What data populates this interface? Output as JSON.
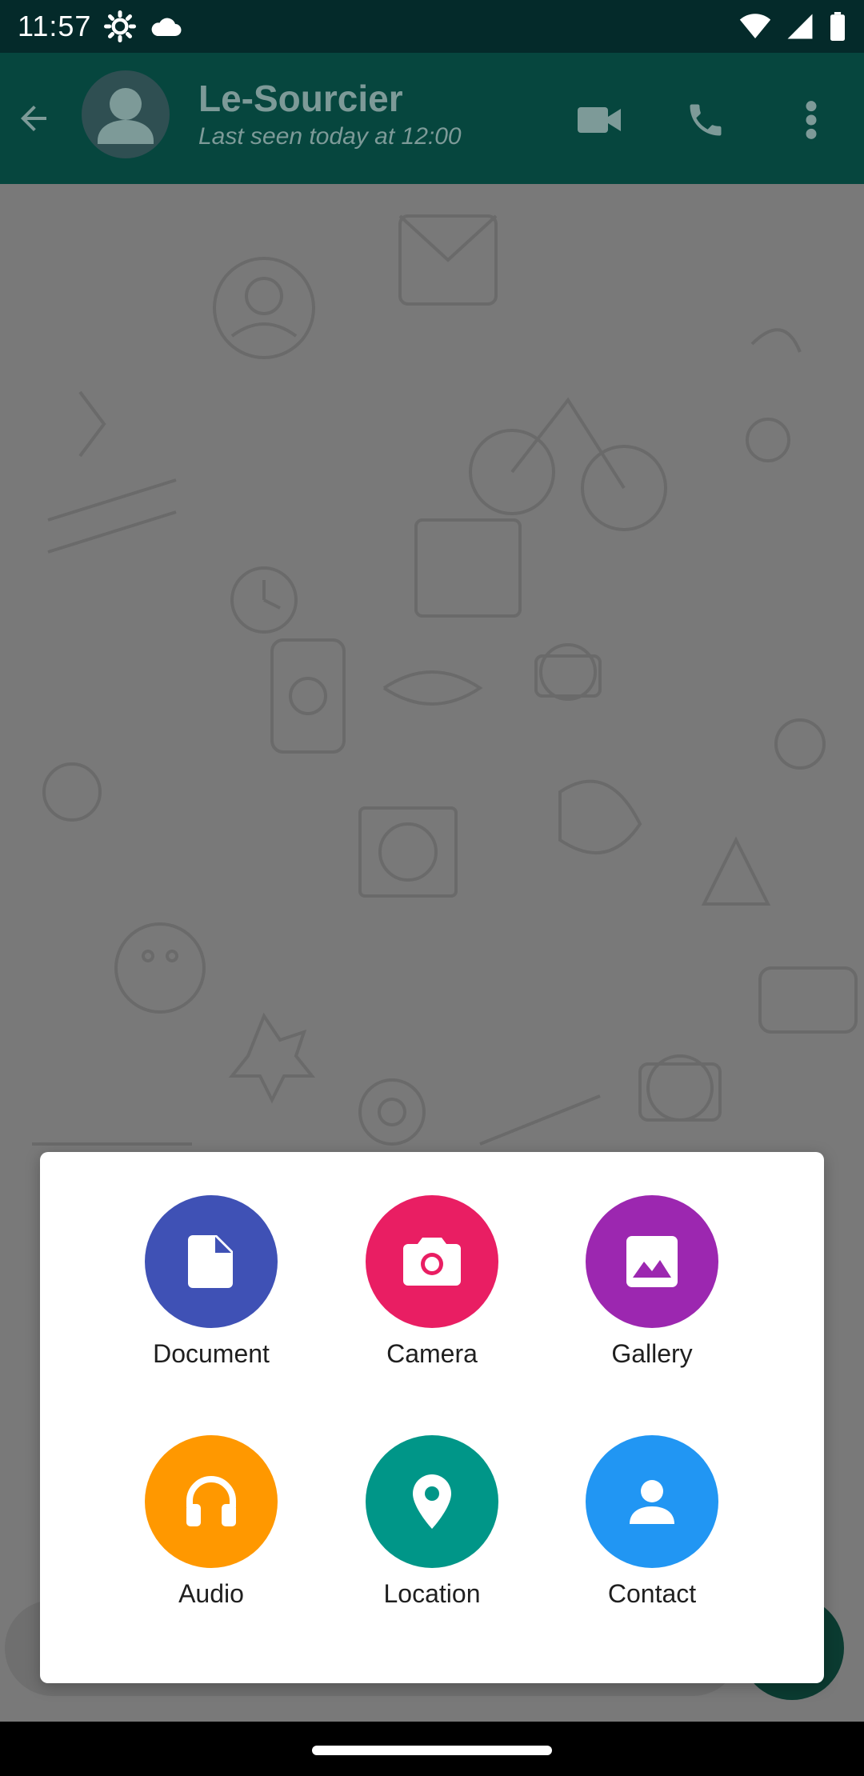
{
  "status_bar": {
    "time": "11:57",
    "left_icons": [
      "settings-icon",
      "cloud-icon"
    ],
    "right_icons": [
      "wifi-icon",
      "signal-icon",
      "battery-icon"
    ]
  },
  "header": {
    "contact_name": "Le-Sourcier",
    "last_seen": "Last seen today at 12:00",
    "icons": [
      "back-arrow-icon",
      "avatar-person-icon",
      "video-call-icon",
      "phone-icon",
      "more-vert-icon"
    ]
  },
  "attachment_menu": {
    "items": [
      {
        "label": "Document",
        "icon": "document-icon",
        "color": "#3f51b5"
      },
      {
        "label": "Camera",
        "icon": "camera-icon",
        "color": "#e91e63"
      },
      {
        "label": "Gallery",
        "icon": "gallery-icon",
        "color": "#9c27b0"
      },
      {
        "label": "Audio",
        "icon": "headphones-icon",
        "color": "#ff9800"
      },
      {
        "label": "Location",
        "icon": "location-pin-icon",
        "color": "#009688"
      },
      {
        "label": "Contact",
        "icon": "contact-person-icon",
        "color": "#2196f3"
      }
    ]
  },
  "colors": {
    "status_bar": "#042a2a",
    "app_bar": "#06463e",
    "chat_background": "#797979",
    "sheet_background": "#ffffff"
  }
}
